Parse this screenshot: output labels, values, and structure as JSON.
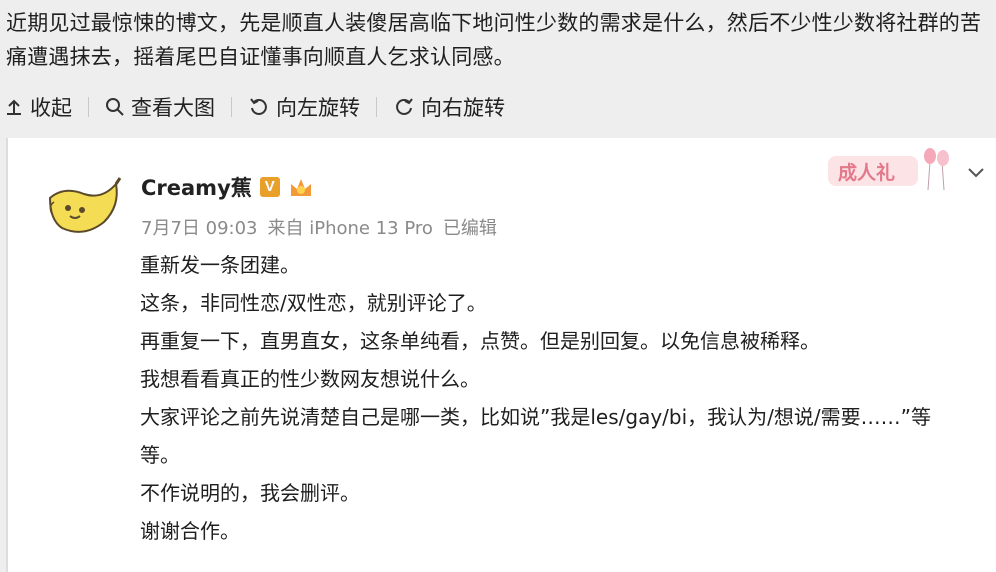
{
  "intro": {
    "text": "近期见过最惊悚的博文，先是顺直人装傻居高临下地问性少数的需求是什么，然后不少性少数将社群的苦痛遭遇抹去，摇着尾巴自证懂事向顺直人乞求认同感。"
  },
  "toolbar": {
    "collapse_label": "收起",
    "view_large_label": "查看大图",
    "rotate_left_label": "向左旋转",
    "rotate_right_label": "向右旋转"
  },
  "post": {
    "username": "Creamy蕉",
    "verified_badge": "V",
    "meta_time": "7月7日 09:03",
    "meta_source": "来自 iPhone 13 Pro",
    "meta_edited": "已编辑",
    "sticker_text": "成人礼",
    "lines": [
      "重新发一条团建。",
      "这条，非同性恋/双性恋，就别评论了。",
      "再重复一下，直男直女，这条单纯看，点赞。但是别回复。以免信息被稀释。",
      "我想看看真正的性少数网友想说什么。",
      "大家评论之前先说清楚自己是哪一类，比如说”我是les/gay/bi，我认为/想说/需要……”等等。",
      "不作说明的，我会删评。",
      "谢谢合作。"
    ]
  },
  "colors": {
    "verified": "#e8a02b",
    "meta_gray": "#8a8a8a",
    "sticker_pink": "#e3788a"
  }
}
